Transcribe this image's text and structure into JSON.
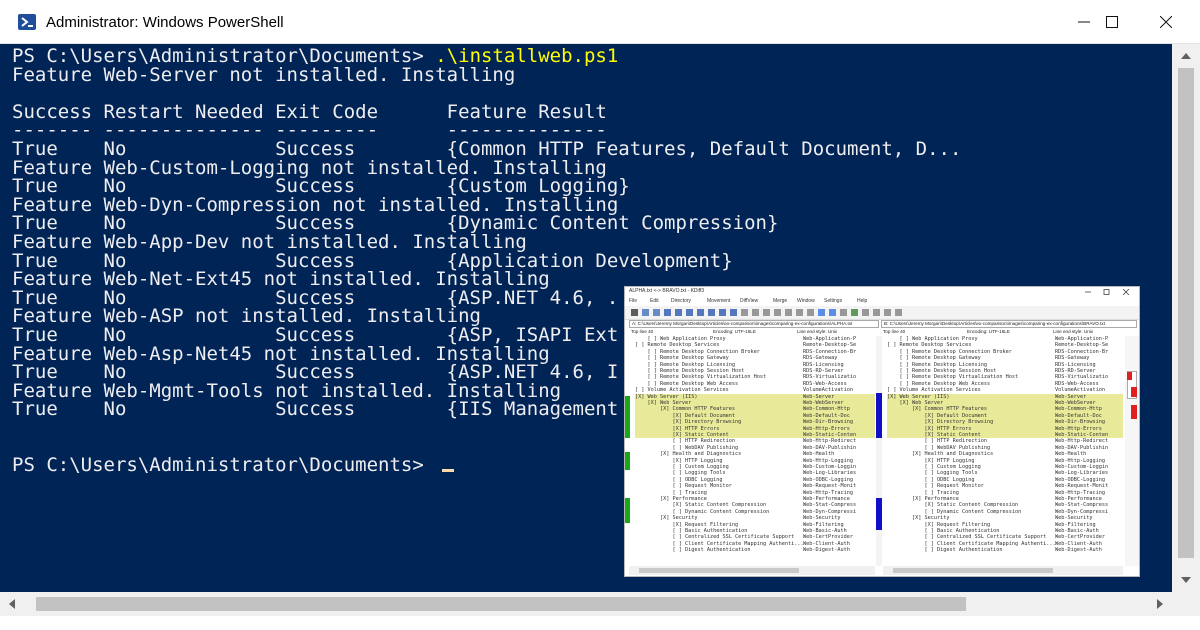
{
  "window": {
    "title": "Administrator: Windows PowerShell",
    "icon": "powershell-icon",
    "buttons": [
      "minimize-icon",
      "maximize-icon",
      "close-icon"
    ]
  },
  "console": {
    "background": "#012456",
    "text_color": "#eeedf0",
    "command_color": "#ffff00",
    "lines": [
      {
        "prompt": "PS C:\\Users\\Administrator\\Documents> ",
        "command": ".\\installweb.ps1"
      },
      {
        "text": "Feature Web-Server not installed. Installing"
      },
      {
        "text": ""
      },
      {
        "text": "Success Restart Needed Exit Code      Feature Result"
      },
      {
        "text": "------- -------------- ---------      --------------"
      },
      {
        "text": "True    No             Success        {Common HTTP Features, Default Document, D..."
      },
      {
        "text": "Feature Web-Custom-Logging not installed. Installing"
      },
      {
        "text": "True    No             Success        {Custom Logging}"
      },
      {
        "text": "Feature Web-Dyn-Compression not installed. Installing"
      },
      {
        "text": "True    No             Success        {Dynamic Content Compression}"
      },
      {
        "text": "Feature Web-App-Dev not installed. Installing"
      },
      {
        "text": "True    No             Success        {Application Development}"
      },
      {
        "text": "Feature Web-Net-Ext45 not installed. Installing"
      },
      {
        "text": "True    No             Success        {ASP.NET 4.6, ."
      },
      {
        "text": "Feature Web-ASP not installed. Installing"
      },
      {
        "text": "True    No             Success        {ASP, ISAPI Ext"
      },
      {
        "text": "Feature Web-Asp-Net45 not installed. Installing"
      },
      {
        "text": "True    No             Success        {ASP.NET 4.6, I"
      },
      {
        "text": "Feature Web-Mgmt-Tools not installed. Installing"
      },
      {
        "text": "True    No             Success        {IIS Management"
      },
      {
        "text": ""
      },
      {
        "text": ""
      },
      {
        "text": "PS C:\\Users\\Administrator\\Documents> "
      }
    ]
  },
  "kdiff": {
    "title": "ALPHA.txt <-> BRAVO.txt - KDiff3",
    "menu": [
      "File",
      "Edit",
      "Directory",
      "Movement",
      "DiffView",
      "Merge",
      "Window",
      "Settings",
      "Help"
    ],
    "pane_a": {
      "path": "A: C:\\Users\\Jeremy Morgan\\Desktop\\Articles\\ex-comparison\\images\\comparing-ex-configurations\\ALPHA.txt",
      "top_line": "Top line 40",
      "encoding": "Encoding: UTF-16LE",
      "line_end": "Line end style: Unix"
    },
    "pane_b": {
      "path": "B: C:\\Users\\Jeremy Morgan\\Desktop\\Articles\\ex-comparison\\images\\comparing-ex-configurations\\BRAVO.txt",
      "top_line": "Top line 40",
      "encoding": "Encoding: UTF-16LE",
      "line_end": "Line end style: Unix"
    },
    "highlight_color": "#e8ea9a",
    "rows": [
      {
        "t": "    [ ] Web Application Proxy",
        "n": "Web-Application-P",
        "hl": false
      },
      {
        "t": "[ ] Remote Desktop Services",
        "n": "Remote-Desktop-Se",
        "hl": false
      },
      {
        "t": "    [ ] Remote Desktop Connection Broker",
        "n": "RDS-Connection-Br",
        "hl": false
      },
      {
        "t": "    [ ] Remote Desktop Gateway",
        "n": "RDS-Gateway",
        "hl": false
      },
      {
        "t": "    [ ] Remote Desktop Licensing",
        "n": "RDS-Licensing",
        "hl": false
      },
      {
        "t": "    [ ] Remote Desktop Session Host",
        "n": "RDS-RD-Server",
        "hl": false
      },
      {
        "t": "    [ ] Remote Desktop Virtualization Host",
        "n": "RDS-Virtualizatio",
        "hl": false
      },
      {
        "t": "    [ ] Remote Desktop Web Access",
        "n": "RDS-Web-Access",
        "hl": false
      },
      {
        "t": "[ ] Volume Activation Services",
        "n": "VolumeActivation",
        "hl": false
      },
      {
        "t": "[X] Web Server (IIS)",
        "n": "Web-Server",
        "hl": true
      },
      {
        "t": "    [X] Web Server",
        "n": "Web-WebServer",
        "hl": true
      },
      {
        "t": "        [X] Common HTTP Features",
        "n": "Web-Common-Http",
        "hl": true
      },
      {
        "t": "            [X] Default Document",
        "n": "Web-Default-Doc",
        "hl": true
      },
      {
        "t": "            [X] Directory Browsing",
        "n": "Web-Dir-Browsing",
        "hl": true
      },
      {
        "t": "            [X] HTTP Errors",
        "n": "Web-Http-Errors",
        "hl": true
      },
      {
        "t": "            [X] Static Content",
        "n": "Web-Static-Conten",
        "hl": true
      },
      {
        "t": "            [ ] HTTP Redirection",
        "n": "Web-Http-Redirect",
        "hl": false
      },
      {
        "t": "            [ ] WebDAV Publishing",
        "n": "Web-DAV-Publishin",
        "hl": false
      },
      {
        "t": "        [X] Health and Diagnostics",
        "n": "Web-Health",
        "hl": false
      },
      {
        "t": "            [X] HTTP Logging",
        "n": "Web-Http-Logging",
        "hl": false
      },
      {
        "t": "            [ ] Custom Logging",
        "n": "Web-Custom-Loggin",
        "hl": false
      },
      {
        "t": "            [ ] Logging Tools",
        "n": "Web-Log-Libraries",
        "hl": false
      },
      {
        "t": "            [ ] ODBC Logging",
        "n": "Web-ODBC-Logging",
        "hl": false
      },
      {
        "t": "            [ ] Request Monitor",
        "n": "Web-Request-Monit",
        "hl": false
      },
      {
        "t": "            [ ] Tracing",
        "n": "Web-Http-Tracing",
        "hl": false
      },
      {
        "t": "        [X] Performance",
        "n": "Web-Performance",
        "hl": false
      },
      {
        "t": "            [X] Static Content Compression",
        "n": "Web-Stat-Compress",
        "hl": false
      },
      {
        "t": "            [ ] Dynamic Content Compression",
        "n": "Web-Dyn-Compressi",
        "hl": false
      },
      {
        "t": "        [X] Security",
        "n": "Web-Security",
        "hl": false
      },
      {
        "t": "            [X] Request Filtering",
        "n": "Web-Filtering",
        "hl": false
      },
      {
        "t": "            [ ] Basic Authentication",
        "n": "Web-Basic-Auth",
        "hl": false
      },
      {
        "t": "            [ ] Centralized SSL Certificate Support",
        "n": "Web-CertProvider",
        "hl": false
      },
      {
        "t": "            [ ] Client Certificate Mapping Authenti...",
        "n": "Web-Client-Auth",
        "hl": false
      },
      {
        "t": "            [ ] Digest Authentication",
        "n": "Web-Digest-Auth",
        "hl": false
      }
    ]
  }
}
